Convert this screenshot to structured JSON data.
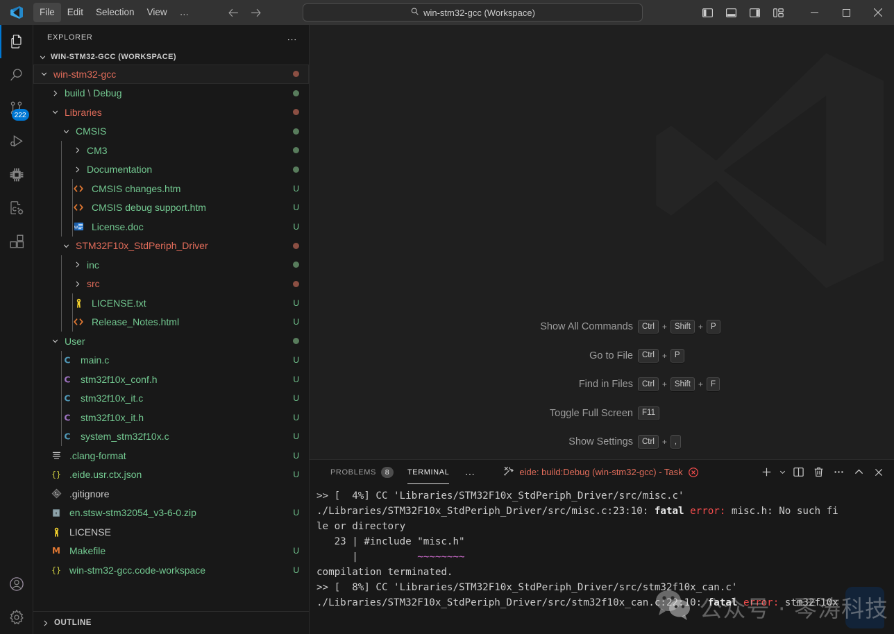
{
  "titlebar": {
    "logo": "vscode-logo",
    "menus": [
      {
        "label": "File",
        "active": true
      },
      {
        "label": "Edit",
        "active": false
      },
      {
        "label": "Selection",
        "active": false
      },
      {
        "label": "View",
        "active": false
      },
      {
        "label": "…",
        "active": false
      }
    ],
    "nav": {
      "back": "arrow-left-icon",
      "forward": "arrow-right-icon"
    },
    "command_center": {
      "icon": "search-icon",
      "text": "win-stm32-gcc (Workspace)"
    },
    "layout_buttons": [
      "toggle-primary-sidebar-icon",
      "toggle-panel-icon",
      "toggle-secondary-sidebar-icon",
      "customize-layout-icon"
    ],
    "window_buttons": [
      "minimize",
      "maximize",
      "close"
    ]
  },
  "activitybar": {
    "items": [
      {
        "name": "explorer",
        "icon": "files-icon",
        "active": true,
        "badge": null
      },
      {
        "name": "search",
        "icon": "search-icon",
        "active": false,
        "badge": null
      },
      {
        "name": "source-control",
        "icon": "source-control-icon",
        "active": false,
        "badge": "222"
      },
      {
        "name": "run-and-debug",
        "icon": "run-debug-icon",
        "active": false,
        "badge": null
      },
      {
        "name": "embedded-ide",
        "icon": "chip-icon",
        "active": false,
        "badge": null
      },
      {
        "name": "cpp-config",
        "icon": "cpp-gear-icon",
        "active": false,
        "badge": null
      },
      {
        "name": "extensions",
        "icon": "extensions-icon",
        "active": false,
        "badge": null
      }
    ],
    "bottom": [
      {
        "name": "accounts",
        "icon": "account-icon"
      },
      {
        "name": "manage",
        "icon": "gear-icon"
      }
    ]
  },
  "sidebar": {
    "title": "EXPLORER",
    "more_actions": "…",
    "workspace_label": "WIN-STM32-GCC (WORKSPACE)",
    "outline_label": "OUTLINE",
    "tree": [
      {
        "label": "win-stm32-gcc",
        "depth": 0,
        "type": "folder",
        "state": "open",
        "color": "#e16c5a",
        "deco": "dot-red",
        "icon": "",
        "focused": true
      },
      {
        "label": "build \\ Debug",
        "depth": 1,
        "type": "folder",
        "state": "closed",
        "color": "#73c991",
        "deco": "dot-green",
        "icon": ""
      },
      {
        "label": "Libraries",
        "depth": 1,
        "type": "folder",
        "state": "open",
        "color": "#e16c5a",
        "deco": "dot-red",
        "icon": ""
      },
      {
        "label": "CMSIS",
        "depth": 2,
        "type": "folder",
        "state": "open",
        "color": "#73c991",
        "deco": "dot-green",
        "icon": ""
      },
      {
        "label": "CM3",
        "depth": 3,
        "type": "folder",
        "state": "closed",
        "color": "#73c991",
        "deco": "dot-green",
        "icon": ""
      },
      {
        "label": "Documentation",
        "depth": 3,
        "type": "folder",
        "state": "closed",
        "color": "#73c991",
        "deco": "dot-green",
        "icon": ""
      },
      {
        "label": "CMSIS changes.htm",
        "depth": 3,
        "type": "file",
        "state": "",
        "color": "#73c991",
        "deco": "U",
        "icon": "html-icon"
      },
      {
        "label": "CMSIS debug support.htm",
        "depth": 3,
        "type": "file",
        "state": "",
        "color": "#73c991",
        "deco": "U",
        "icon": "html-icon"
      },
      {
        "label": "License.doc",
        "depth": 3,
        "type": "file",
        "state": "",
        "color": "#73c991",
        "deco": "U",
        "icon": "word-icon"
      },
      {
        "label": "STM32F10x_StdPeriph_Driver",
        "depth": 2,
        "type": "folder",
        "state": "open",
        "color": "#e16c5a",
        "deco": "dot-red",
        "icon": ""
      },
      {
        "label": "inc",
        "depth": 3,
        "type": "folder",
        "state": "closed",
        "color": "#73c991",
        "deco": "dot-green",
        "icon": ""
      },
      {
        "label": "src",
        "depth": 3,
        "type": "folder",
        "state": "closed",
        "color": "#e16c5a",
        "deco": "dot-red",
        "icon": ""
      },
      {
        "label": "LICENSE.txt",
        "depth": 3,
        "type": "file",
        "state": "",
        "color": "#73c991",
        "deco": "U",
        "icon": "license-icon"
      },
      {
        "label": "Release_Notes.html",
        "depth": 3,
        "type": "file",
        "state": "",
        "color": "#73c991",
        "deco": "U",
        "icon": "html-icon"
      },
      {
        "label": "User",
        "depth": 1,
        "type": "folder",
        "state": "open",
        "color": "#73c991",
        "deco": "dot-green",
        "icon": ""
      },
      {
        "label": "main.c",
        "depth": 2,
        "type": "file",
        "state": "",
        "color": "#73c991",
        "deco": "U",
        "icon": "c-icon"
      },
      {
        "label": "stm32f10x_conf.h",
        "depth": 2,
        "type": "file",
        "state": "",
        "color": "#73c991",
        "deco": "U",
        "icon": "h-icon"
      },
      {
        "label": "stm32f10x_it.c",
        "depth": 2,
        "type": "file",
        "state": "",
        "color": "#73c991",
        "deco": "U",
        "icon": "c-icon"
      },
      {
        "label": "stm32f10x_it.h",
        "depth": 2,
        "type": "file",
        "state": "",
        "color": "#73c991",
        "deco": "U",
        "icon": "h-icon"
      },
      {
        "label": "system_stm32f10x.c",
        "depth": 2,
        "type": "file",
        "state": "",
        "color": "#73c991",
        "deco": "U",
        "icon": "c-icon"
      },
      {
        "label": ".clang-format",
        "depth": 1,
        "type": "file",
        "state": "",
        "color": "#73c991",
        "deco": "U",
        "icon": "settings-file-icon"
      },
      {
        "label": ".eide.usr.ctx.json",
        "depth": 1,
        "type": "file",
        "state": "",
        "color": "#73c991",
        "deco": "U",
        "icon": "json-icon"
      },
      {
        "label": ".gitignore",
        "depth": 1,
        "type": "file",
        "state": "",
        "color": "#cccccc",
        "deco": "",
        "icon": "git-icon"
      },
      {
        "label": "en.stsw-stm32054_v3-6-0.zip",
        "depth": 1,
        "type": "file",
        "state": "",
        "color": "#73c991",
        "deco": "U",
        "icon": "zip-icon"
      },
      {
        "label": "LICENSE",
        "depth": 1,
        "type": "file",
        "state": "",
        "color": "#cccccc",
        "deco": "",
        "icon": "license-icon"
      },
      {
        "label": "Makefile",
        "depth": 1,
        "type": "file",
        "state": "",
        "color": "#73c991",
        "deco": "U",
        "icon": "makefile-icon"
      },
      {
        "label": "win-stm32-gcc.code-workspace",
        "depth": 1,
        "type": "file",
        "state": "",
        "color": "#73c991",
        "deco": "U",
        "icon": "json-icon"
      }
    ]
  },
  "editor": {
    "watermark_logo": "vscode-logo-watermark",
    "keybindings": [
      {
        "label": "Show All Commands",
        "keys": [
          "Ctrl",
          "+",
          "Shift",
          "+",
          "P"
        ]
      },
      {
        "label": "Go to File",
        "keys": [
          "Ctrl",
          "+",
          "P"
        ]
      },
      {
        "label": "Find in Files",
        "keys": [
          "Ctrl",
          "+",
          "Shift",
          "+",
          "F"
        ]
      },
      {
        "label": "Toggle Full Screen",
        "keys": [
          "F11"
        ]
      },
      {
        "label": "Show Settings",
        "keys": [
          "Ctrl",
          "+",
          ","
        ]
      }
    ]
  },
  "panel": {
    "tabs": [
      {
        "label": "PROBLEMS",
        "badge": "8",
        "active": false
      },
      {
        "label": "TERMINAL",
        "badge": null,
        "active": true
      }
    ],
    "more_tabs": "…",
    "terminal_tab": {
      "icon": "tools-icon",
      "label": "eide: build:Debug (win-stm32-gcc) - Task",
      "status_icon": "error-circle-icon"
    },
    "actions": [
      "new-terminal-icon",
      "terminal-dropdown-icon",
      "split-terminal-icon",
      "kill-terminal-icon",
      "panel-more-icon",
      "maximize-panel-icon",
      "close-panel-icon"
    ],
    "terminal_lines": [
      {
        "segments": [
          {
            "t": ">> [  4%] CC 'Libraries/STM32F10x_StdPeriph_Driver/src/misc.c'",
            "c": "plain"
          }
        ]
      },
      {
        "segments": [
          {
            "t": "./Libraries/STM32F10x_StdPeriph_Driver/src/misc.c:23:10: ",
            "c": "plain"
          },
          {
            "t": "fatal ",
            "c": "bold"
          },
          {
            "t": "error: ",
            "c": "err"
          },
          {
            "t": "misc.h: No such fi",
            "c": "plain"
          }
        ]
      },
      {
        "segments": [
          {
            "t": "le or directory",
            "c": "plain"
          }
        ]
      },
      {
        "segments": [
          {
            "t": "   23 | #include \"misc.h\"",
            "c": "plain"
          }
        ]
      },
      {
        "segments": [
          {
            "t": "      |          ",
            "c": "plain"
          },
          {
            "t": "~~~~~~~~",
            "c": "squig"
          }
        ]
      },
      {
        "segments": [
          {
            "t": "compilation terminated.",
            "c": "plain"
          }
        ]
      },
      {
        "segments": [
          {
            "t": ">> [  8%] CC 'Libraries/STM32F10x_StdPeriph_Driver/src/stm32f10x_can.c'",
            "c": "plain"
          }
        ]
      },
      {
        "segments": [
          {
            "t": "./Libraries/STM32F10x_StdPeriph_Driver/src/stm32f10x_can.c:22:10: ",
            "c": "plain"
          },
          {
            "t": "fatal ",
            "c": "bold"
          },
          {
            "t": "error: ",
            "c": "err"
          },
          {
            "t": "stm32f10x",
            "c": "plain"
          }
        ]
      }
    ]
  },
  "watermark": {
    "icon": "wechat-icon",
    "text": "公众号 · 琴涛科技"
  },
  "colors": {
    "accent": "#0078d4",
    "untracked_green": "#73c991",
    "modified_red": "#e16c5a",
    "error_red": "#f14c4c"
  }
}
